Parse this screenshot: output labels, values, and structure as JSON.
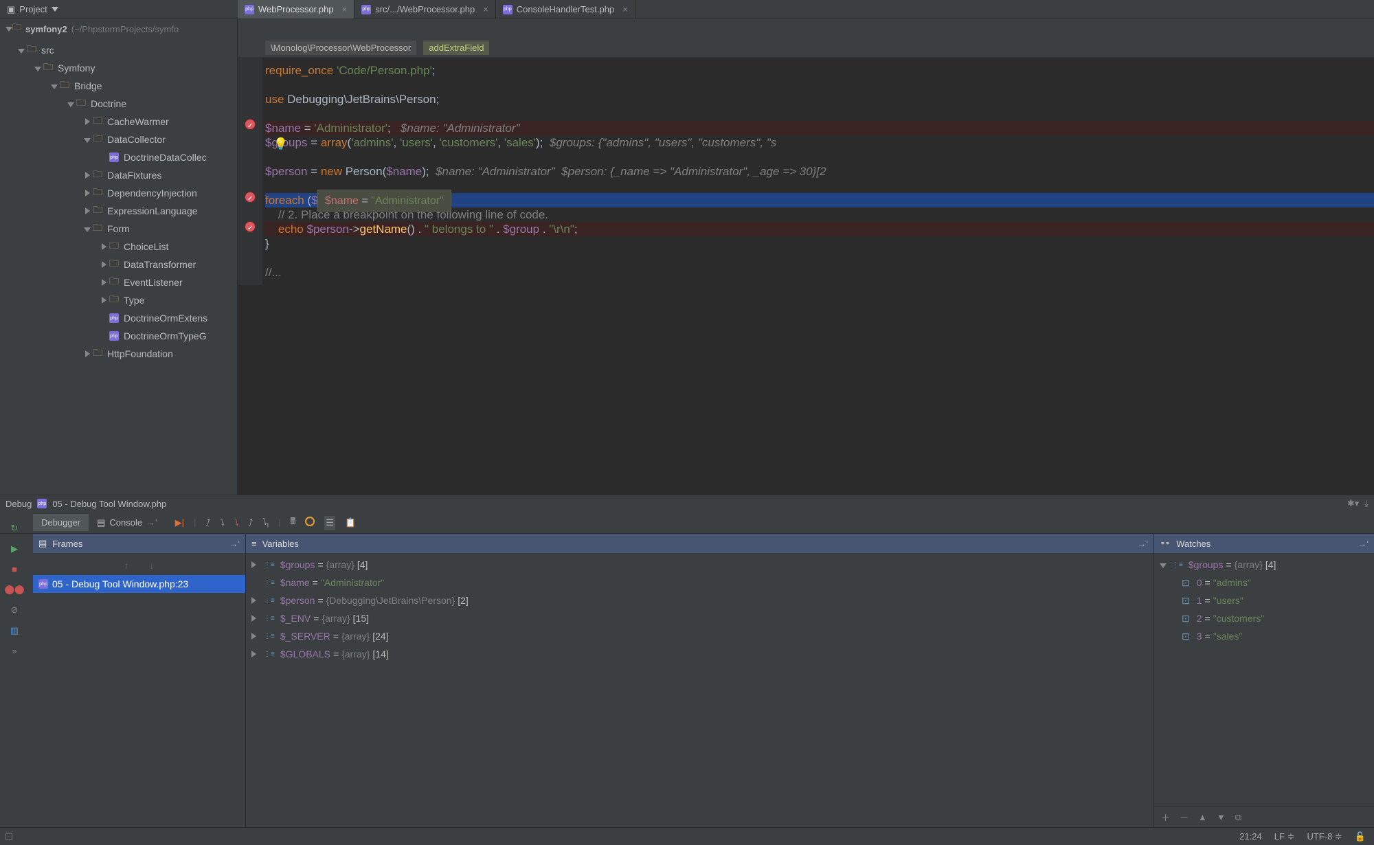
{
  "toolbar": {
    "project_label": "Project"
  },
  "tabs": [
    {
      "label": "WebProcessor.php",
      "active": true
    },
    {
      "label": "src/.../WebProcessor.php",
      "active": false
    },
    {
      "label": "ConsoleHandlerTest.php",
      "active": false
    }
  ],
  "project_tree": {
    "root": "symfony2",
    "root_path": "(~/PhpstormProjects/symfo",
    "nodes": [
      {
        "depth": 1,
        "open": true,
        "icon": "folder",
        "label": "src"
      },
      {
        "depth": 2,
        "open": true,
        "icon": "folder",
        "label": "Symfony"
      },
      {
        "depth": 3,
        "open": true,
        "icon": "folder",
        "label": "Bridge"
      },
      {
        "depth": 4,
        "open": true,
        "icon": "folder",
        "label": "Doctrine"
      },
      {
        "depth": 5,
        "open": false,
        "icon": "folder",
        "label": "CacheWarmer"
      },
      {
        "depth": 5,
        "open": true,
        "icon": "folder",
        "label": "DataCollector"
      },
      {
        "depth": 6,
        "open": null,
        "icon": "php",
        "label": "DoctrineDataCollec"
      },
      {
        "depth": 5,
        "open": false,
        "icon": "folder",
        "label": "DataFixtures"
      },
      {
        "depth": 5,
        "open": false,
        "icon": "folder",
        "label": "DependencyInjection"
      },
      {
        "depth": 5,
        "open": false,
        "icon": "folder",
        "label": "ExpressionLanguage"
      },
      {
        "depth": 5,
        "open": true,
        "icon": "folder",
        "label": "Form"
      },
      {
        "depth": 6,
        "open": false,
        "icon": "folder",
        "label": "ChoiceList"
      },
      {
        "depth": 6,
        "open": false,
        "icon": "folder",
        "label": "DataTransformer"
      },
      {
        "depth": 6,
        "open": false,
        "icon": "folder",
        "label": "EventListener"
      },
      {
        "depth": 6,
        "open": false,
        "icon": "folder",
        "label": "Type"
      },
      {
        "depth": 6,
        "open": null,
        "icon": "php",
        "label": "DoctrineOrmExtens"
      },
      {
        "depth": 6,
        "open": null,
        "icon": "php",
        "label": "DoctrineOrmTypeG"
      },
      {
        "depth": 5,
        "open": false,
        "icon": "folder",
        "label": "HttpFoundation"
      }
    ]
  },
  "breadcrumb": {
    "seg1": "\\Monolog\\Processor\\WebProcessor",
    "seg2": "addExtraField"
  },
  "code": {
    "l1_a": "require_once",
    "l1_b": " 'Code/Person.php'",
    "l1_c": ";",
    "l2_a": "use",
    "l2_b": " Debugging\\JetBrains\\Person;",
    "l3_a": "$name",
    "l3_b": " = ",
    "l3_c": "'Administrator'",
    "l3_d": ";   ",
    "l3_inl": "$name: \"Administrator\"",
    "l4_a": "$groups",
    "l4_b": " = ",
    "l4_c": "array",
    "l4_d": "(",
    "l4_e": "'admins'",
    "l4_f": ", ",
    "l4_g": "'users'",
    "l4_h": ", ",
    "l4_i": "'customers'",
    "l4_j": ", ",
    "l4_k": "'sales'",
    "l4_l": ");  ",
    "l4_inl": "$groups: {\"admins\", \"users\", \"customers\", \"s",
    "l5_a": "$person",
    "l5_b": " = ",
    "l5_c": "new",
    "l5_d": " Person(",
    "l5_e": "$name",
    "l5_f": ");  ",
    "l5_inl1": "$name: \"Administrator\"  ",
    "l5_inl2": "$person: {_name => \"Administrator\", _age => 30}[2",
    "l6_a": "foreach",
    "l6_b": " (",
    "l6_c": "$g",
    "tooltip_var": "$name",
    "tooltip_eq": " = ",
    "tooltip_val": "\"Administrator\"",
    "l7_cmt": "    // 2. Place a breakpoint on the following line of code.",
    "l8_a": "    echo",
    "l8_b": " $person",
    "l8_c": "->",
    "l8_d": "getName",
    "l8_e": "() . ",
    "l8_f": "\" belongs to \"",
    "l8_g": " . ",
    "l8_h": "$group",
    "l8_i": " . ",
    "l8_j": "\"\\r\\n\"",
    "l8_k": ";",
    "l9": "}",
    "l10": "//..."
  },
  "debug": {
    "title_prefix": "Debug",
    "title": "05 - Debug Tool Window.php",
    "tabs": {
      "debugger": "Debugger",
      "console": "Console"
    },
    "frames_title": "Frames",
    "variables_title": "Variables",
    "watches_title": "Watches",
    "frame": "05 - Debug Tool Window.php:23",
    "vars": [
      {
        "exp": true,
        "name": "$groups",
        "op": " = ",
        "type": "{array} ",
        "bracket": "[4]"
      },
      {
        "exp": null,
        "name": "$name",
        "op": " = ",
        "val": "\"Administrator\""
      },
      {
        "exp": true,
        "name": "$person",
        "op": " = ",
        "type": "{Debugging\\JetBrains\\Person} ",
        "bracket": "[2]"
      },
      {
        "exp": true,
        "name": "$_ENV",
        "op": " = ",
        "type": "{array} ",
        "bracket": "[15]"
      },
      {
        "exp": true,
        "name": "$_SERVER",
        "op": " = ",
        "type": "{array} ",
        "bracket": "[24]"
      },
      {
        "exp": true,
        "name": "$GLOBALS",
        "op": " = ",
        "type": "{array} ",
        "bracket": "[14]"
      }
    ],
    "watches": {
      "root": {
        "name": "$groups",
        "op": " = ",
        "type": "{array} ",
        "bracket": "[4]"
      },
      "items": [
        {
          "k": "0",
          "v": "\"admins\""
        },
        {
          "k": "1",
          "v": "\"users\""
        },
        {
          "k": "2",
          "v": "\"customers\""
        },
        {
          "k": "3",
          "v": "\"sales\""
        }
      ]
    }
  },
  "status": {
    "pos": "21:24",
    "sep": "LF ≑",
    "enc": "UTF-8 ≑"
  }
}
